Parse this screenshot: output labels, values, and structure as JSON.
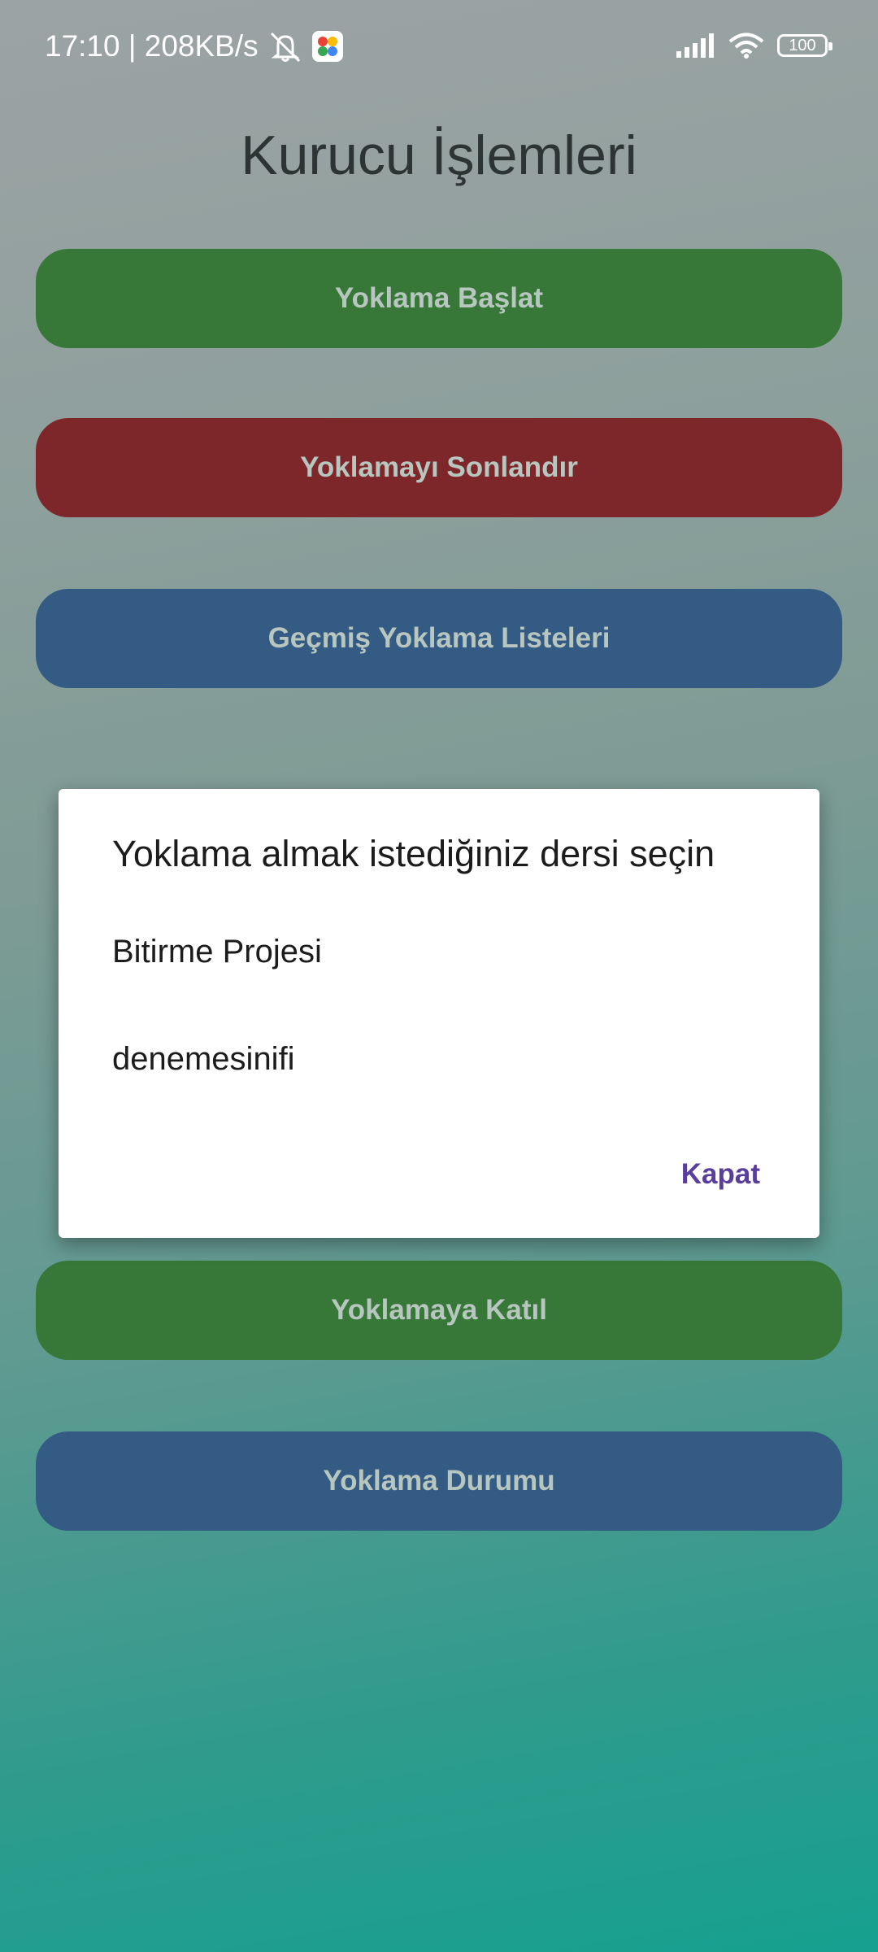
{
  "status_bar": {
    "time_speed": "17:10 | 208KB/s",
    "battery": "100",
    "icons": [
      "mute-notification-icon",
      "photos-app-icon",
      "signal-icon",
      "wifi-icon",
      "battery-icon"
    ]
  },
  "page": {
    "title": "Kurucu İşlemleri"
  },
  "buttons": {
    "start": "Yoklama Başlat",
    "end": "Yoklamayı Sonlandır",
    "history": "Geçmiş Yoklama Listeleri",
    "join": "Yoklamaya Katıl",
    "status": "Yoklama Durumu"
  },
  "dialog": {
    "title": "Yoklama almak istediğiniz dersi seçin",
    "items": [
      "Bitirme Projesi",
      "denemesinifi"
    ],
    "close": "Kapat"
  },
  "colors": {
    "green_button": "#377838",
    "red_button": "#7d272a",
    "blue_button": "#335b83",
    "dialog_accent": "#5a3e9c"
  }
}
